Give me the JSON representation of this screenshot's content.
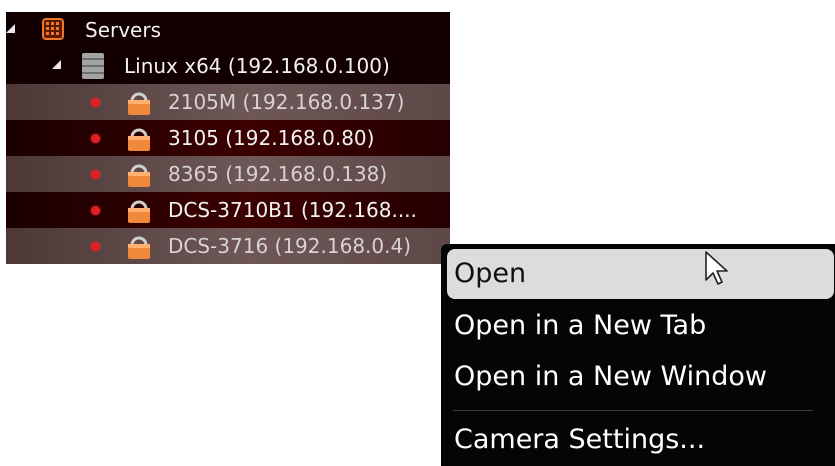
{
  "tree": {
    "root": {
      "label": "Servers",
      "icon": "server-group-icon",
      "expanded": true
    },
    "host": {
      "label": "Linux x64 (192.168.0.100)",
      "icon": "server-rack-icon",
      "expanded": true
    },
    "cameras": [
      {
        "label": "2105M (192.168.0.137)",
        "status": "offline",
        "highlighted": true
      },
      {
        "label": "3105 (192.168.0.80)",
        "status": "offline",
        "highlighted": false
      },
      {
        "label": "8365 (192.168.0.138)",
        "status": "offline",
        "highlighted": true
      },
      {
        "label": "DCS-3710B1 (192.168....",
        "status": "offline",
        "highlighted": false
      },
      {
        "label": "DCS-3716 (192.168.0.4)",
        "status": "offline",
        "highlighted": true
      }
    ]
  },
  "context_menu": {
    "items": [
      {
        "label": "Open",
        "hovered": true
      },
      {
        "label": "Open in a New Tab"
      },
      {
        "label": "Open in a New Window"
      },
      {
        "label": "Camera Settings..."
      }
    ]
  },
  "colors": {
    "tree_background": "#120000",
    "status_dot": "#e02020",
    "menu_background": "#050505",
    "menu_hover": "#dcdcdc",
    "server_icon_accent": "#f07828",
    "camera_icon_accent": "#f08a3a"
  }
}
